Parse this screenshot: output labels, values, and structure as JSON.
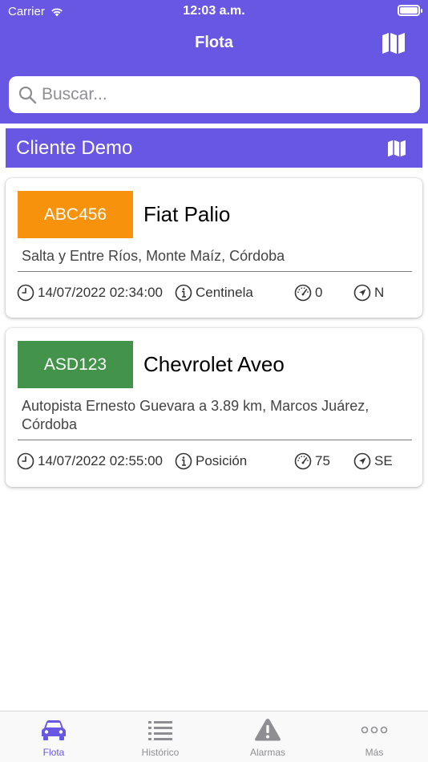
{
  "status_bar": {
    "carrier": "Carrier",
    "time": "12:03 a.m."
  },
  "nav": {
    "title": "Flota",
    "map_icon": "map-icon"
  },
  "search": {
    "placeholder": "Buscar...",
    "value": ""
  },
  "group": {
    "title": "Cliente Demo"
  },
  "vehicles": [
    {
      "plate": "ABC456",
      "plate_color": "#f7920c",
      "name": "Fiat Palio",
      "address": "Salta y Entre Ríos, Monte Maíz, Córdoba",
      "datetime": "14/07/2022 02:34:00",
      "event": "Centinela",
      "speed": "0",
      "direction": "N"
    },
    {
      "plate": "ASD123",
      "plate_color": "#43934a",
      "name": "Chevrolet Aveo",
      "address": "Autopista Ernesto Guevara a 3.89 km, Marcos Juárez, Córdoba",
      "datetime": "14/07/2022 02:55:00",
      "event": "Posición",
      "speed": "75",
      "direction": "SE"
    }
  ],
  "tabs": [
    {
      "label": "Flota",
      "icon": "car-icon",
      "active": true
    },
    {
      "label": "Histórico",
      "icon": "list-icon",
      "active": false
    },
    {
      "label": "Alarmas",
      "icon": "warning-icon",
      "active": false
    },
    {
      "label": "Más",
      "icon": "more-icon",
      "active": false
    }
  ],
  "colors": {
    "primary": "#6857e3",
    "inactive": "#8e8e93"
  }
}
